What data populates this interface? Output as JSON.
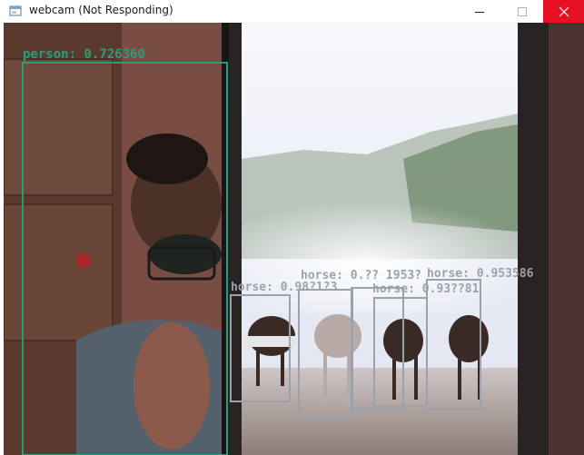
{
  "window": {
    "title": "webcam (Not Responding)",
    "controls": [
      "minimize",
      "maximize",
      "close"
    ]
  },
  "detections": [
    {
      "label": "person: 0.726360",
      "class": "person",
      "color": "#2a9d78"
    },
    {
      "label": "horse: 0.98?1?3",
      "class": "horse",
      "color": "#9aa2ac"
    },
    {
      "label": "horse: 0.?? 1953?",
      "class": "horse",
      "color": "#9aa2ac"
    },
    {
      "label": "horse: 0.953586",
      "class": "horse",
      "color": "#9aa2ac"
    },
    {
      "label": "horse: 0.93??81",
      "class": "horse",
      "color": "#9aa2ac"
    }
  ],
  "colors": {
    "person_box": "#2a9d78",
    "horse_box": "#9aa2ac",
    "close_button": "#e81123"
  }
}
